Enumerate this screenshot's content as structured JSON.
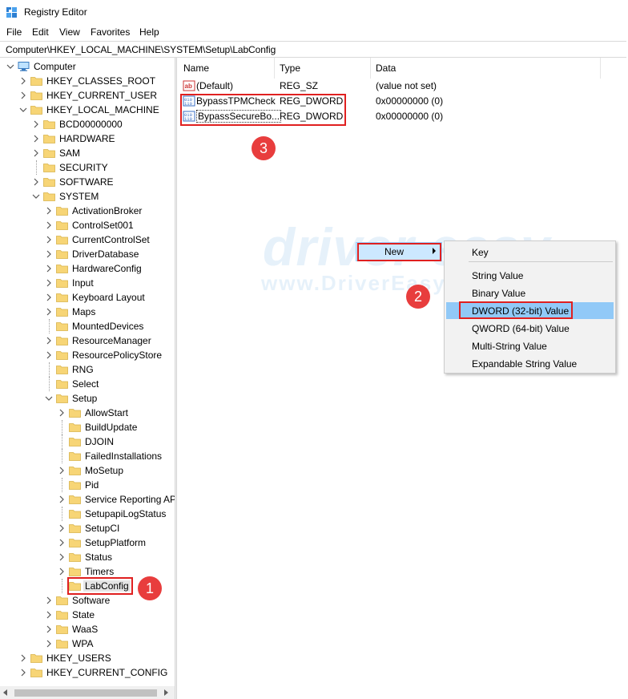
{
  "window": {
    "title": "Registry Editor"
  },
  "menu": [
    "File",
    "Edit",
    "View",
    "Favorites",
    "Help"
  ],
  "address": "Computer\\HKEY_LOCAL_MACHINE\\SYSTEM\\Setup\\LabConfig",
  "tree": [
    {
      "label": "Computer",
      "level": 0,
      "expanded": true
    },
    {
      "label": "HKEY_CLASSES_ROOT",
      "level": 1,
      "expanded": false
    },
    {
      "label": "HKEY_CURRENT_USER",
      "level": 1,
      "expanded": false
    },
    {
      "label": "HKEY_LOCAL_MACHINE",
      "level": 1,
      "expanded": true
    },
    {
      "label": "BCD00000000",
      "level": 2,
      "expanded": false
    },
    {
      "label": "HARDWARE",
      "level": 2,
      "expanded": false
    },
    {
      "label": "SAM",
      "level": 2,
      "expanded": false
    },
    {
      "label": "SECURITY",
      "level": 2,
      "leaf": true
    },
    {
      "label": "SOFTWARE",
      "level": 2,
      "expanded": false
    },
    {
      "label": "SYSTEM",
      "level": 2,
      "expanded": true
    },
    {
      "label": "ActivationBroker",
      "level": 3,
      "expanded": false
    },
    {
      "label": "ControlSet001",
      "level": 3,
      "expanded": false
    },
    {
      "label": "CurrentControlSet",
      "level": 3,
      "expanded": false
    },
    {
      "label": "DriverDatabase",
      "level": 3,
      "expanded": false
    },
    {
      "label": "HardwareConfig",
      "level": 3,
      "expanded": false
    },
    {
      "label": "Input",
      "level": 3,
      "expanded": false
    },
    {
      "label": "Keyboard Layout",
      "level": 3,
      "expanded": false
    },
    {
      "label": "Maps",
      "level": 3,
      "expanded": false
    },
    {
      "label": "MountedDevices",
      "level": 3,
      "leaf": true
    },
    {
      "label": "ResourceManager",
      "level": 3,
      "expanded": false
    },
    {
      "label": "ResourcePolicyStore",
      "level": 3,
      "expanded": false
    },
    {
      "label": "RNG",
      "level": 3,
      "leaf": true
    },
    {
      "label": "Select",
      "level": 3,
      "leaf": true
    },
    {
      "label": "Setup",
      "level": 3,
      "expanded": true
    },
    {
      "label": "AllowStart",
      "level": 4,
      "expanded": false
    },
    {
      "label": "BuildUpdate",
      "level": 4,
      "leaf": true
    },
    {
      "label": "DJOIN",
      "level": 4,
      "leaf": true
    },
    {
      "label": "FailedInstallations",
      "level": 4,
      "leaf": true
    },
    {
      "label": "MoSetup",
      "level": 4,
      "expanded": false
    },
    {
      "label": "Pid",
      "level": 4,
      "leaf": true
    },
    {
      "label": "Service Reporting API",
      "level": 4,
      "expanded": false
    },
    {
      "label": "SetupapiLogStatus",
      "level": 4,
      "leaf": true
    },
    {
      "label": "SetupCI",
      "level": 4,
      "expanded": false
    },
    {
      "label": "SetupPlatform",
      "level": 4,
      "expanded": false
    },
    {
      "label": "Status",
      "level": 4,
      "expanded": false
    },
    {
      "label": "Timers",
      "level": 4,
      "expanded": false
    },
    {
      "label": "LabConfig",
      "level": 4,
      "leaf": true,
      "selected": true
    },
    {
      "label": "Software",
      "level": 3,
      "expanded": false
    },
    {
      "label": "State",
      "level": 3,
      "expanded": false
    },
    {
      "label": "WaaS",
      "level": 3,
      "expanded": false
    },
    {
      "label": "WPA",
      "level": 3,
      "expanded": false
    },
    {
      "label": "HKEY_USERS",
      "level": 1,
      "expanded": false
    },
    {
      "label": "HKEY_CURRENT_CONFIG",
      "level": 1,
      "expanded": false
    }
  ],
  "columns": {
    "name": "Name",
    "type": "Type",
    "data": "Data"
  },
  "values": [
    {
      "name": "(Default)",
      "type": "REG_SZ",
      "data": "(value not set)",
      "icon": "string-value-icon"
    },
    {
      "name": "BypassTPMCheck",
      "type": "REG_DWORD",
      "data": "0x00000000 (0)",
      "icon": "binary-value-icon"
    },
    {
      "name": "BypassSecureBo...",
      "type": "REG_DWORD",
      "data": "0x00000000 (0)",
      "icon": "binary-value-icon"
    }
  ],
  "context_menu": {
    "new_label": "New"
  },
  "submenu": [
    "Key",
    "String Value",
    "Binary Value",
    "DWORD (32-bit) Value",
    "QWORD (64-bit) Value",
    "Multi-String Value",
    "Expandable String Value"
  ],
  "badges": [
    "1",
    "2",
    "3"
  ],
  "watermark": {
    "line1": "driver easy",
    "line2": "www.DriverEasy.com"
  },
  "colors": {
    "selection": "#cce8ff",
    "highlight": "#91c9f7",
    "annotation": "#e02020",
    "badge": "#e83d3d",
    "folder": "#f7d576"
  }
}
